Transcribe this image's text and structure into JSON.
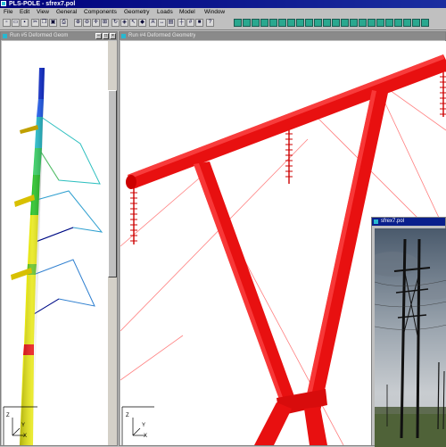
{
  "app": {
    "title": "PLS-POLE - sfrex7.pol"
  },
  "menu": [
    "File",
    "Edit",
    "View",
    "General",
    "Components",
    "Geometry",
    "Loads",
    "Model",
    "Window"
  ],
  "windows": {
    "left": {
      "title": "Run #5 Deformed Geom",
      "axis": {
        "z": "Z",
        "y": "Y",
        "x": "X"
      }
    },
    "main": {
      "title": "Run #4 Deformed Geometry",
      "axis": {
        "z": "Z",
        "y": "Y",
        "x": "X"
      }
    },
    "photo": {
      "title": "sfrex7.pol"
    }
  },
  "colors": {
    "pole_red": "#e81010",
    "insulator_red": "#cc0000",
    "guy_line": "#ff7070",
    "title_active": "#0a1f8c"
  }
}
